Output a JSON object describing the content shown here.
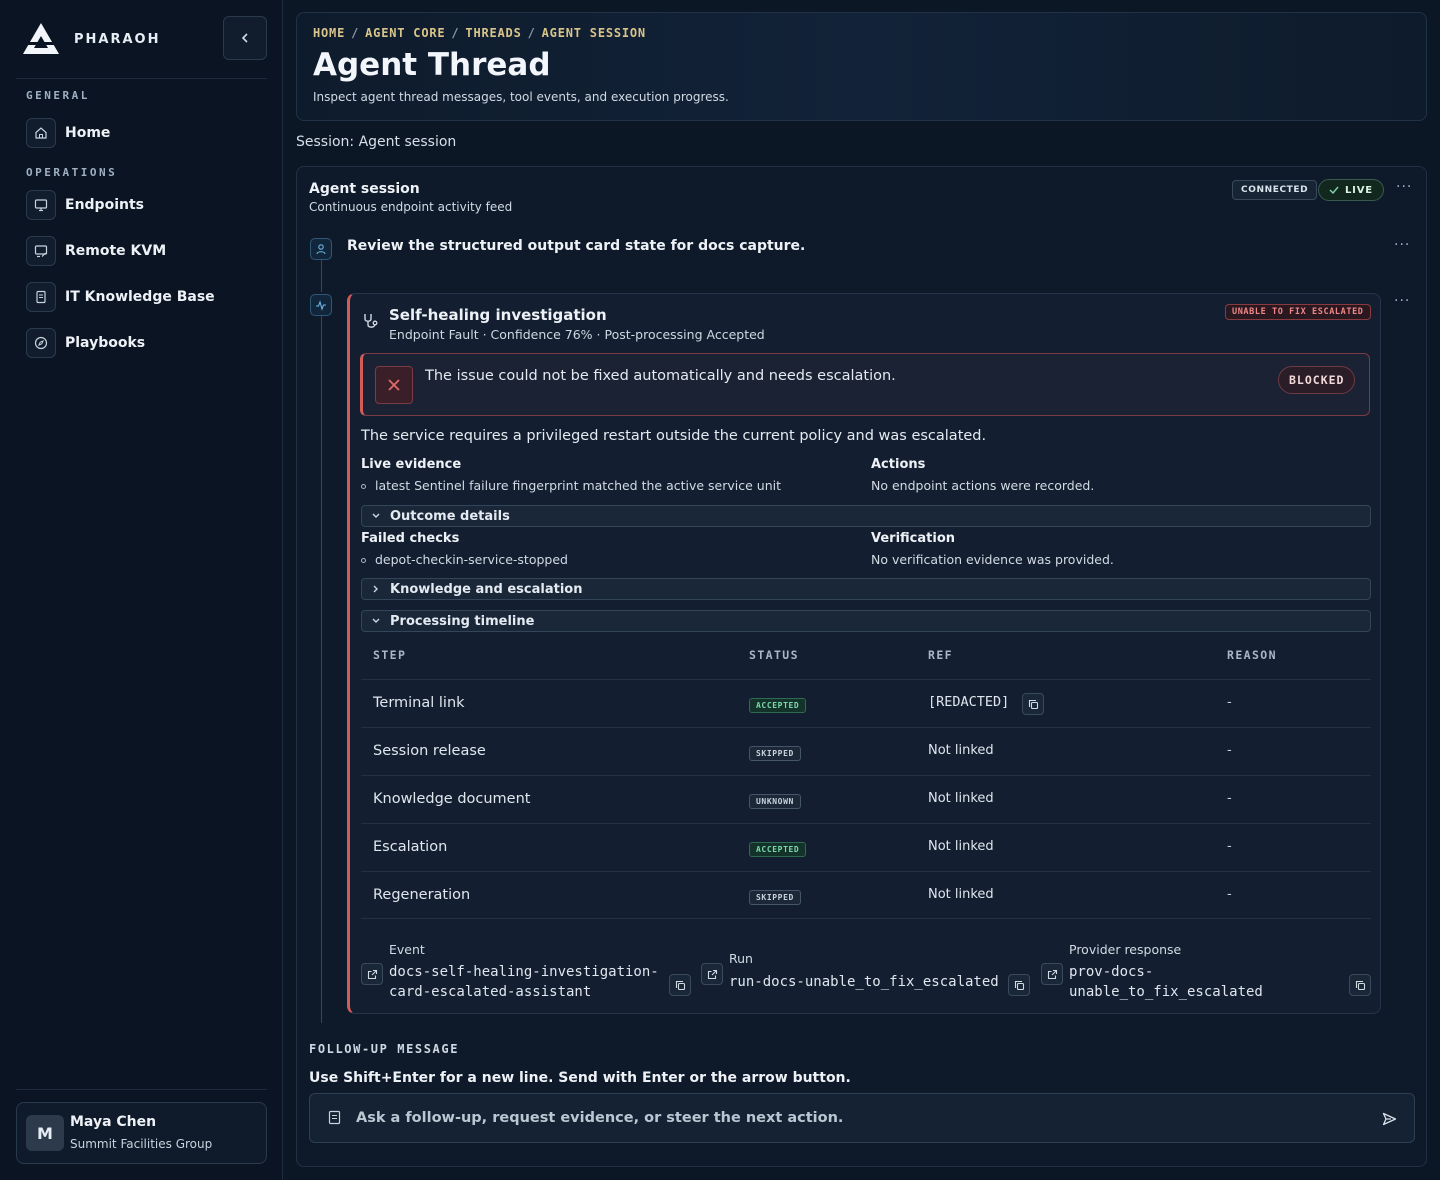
{
  "brand": {
    "name": "PHARAOH",
    "collapse_icon": "chevron-left-icon"
  },
  "sidebar": {
    "sections": [
      {
        "label": "GENERAL"
      },
      {
        "label": "OPERATIONS"
      }
    ],
    "items": [
      {
        "label": "Home",
        "icon": "home-icon"
      },
      {
        "label": "Endpoints",
        "icon": "monitor-icon"
      },
      {
        "label": "Remote KVM",
        "icon": "remote-screen-icon"
      },
      {
        "label": "IT Knowledge Base",
        "icon": "book-icon"
      },
      {
        "label": "Playbooks",
        "icon": "compass-icon"
      }
    ],
    "user": {
      "initial": "M",
      "name": "Maya Chen",
      "org": "Summit Facilities Group"
    }
  },
  "header": {
    "breadcrumb": [
      "HOME",
      "AGENT CORE",
      "THREADS",
      "AGENT SESSION"
    ],
    "title": "Agent Thread",
    "subtitle": "Inspect agent thread messages, tool events, and execution progress."
  },
  "session_label": "Session: Agent session",
  "session": {
    "title": "Agent session",
    "subtitle": "Continuous endpoint activity feed",
    "connected_badge": "CONNECTED",
    "live_badge": "LIVE",
    "more": "···"
  },
  "user_message": "Review the structured output card state for docs capture.",
  "investigation": {
    "title": "Self-healing investigation",
    "meta": "Endpoint Fault · Confidence 76% · Post-processing Accepted",
    "status_badge": "UNABLE TO FIX ESCALATED",
    "alert_text": "The issue could not be fixed automatically and needs escalation.",
    "alert_badge": "BLOCKED",
    "summary": "The service requires a privileged restart outside the current policy and was escalated.",
    "live_evidence_heading": "Live evidence",
    "live_evidence_item": "latest Sentinel failure fingerprint matched the active service unit",
    "actions_heading": "Actions",
    "actions_text": "No endpoint actions were recorded.",
    "outcome_label": "Outcome details",
    "failed_checks_heading": "Failed checks",
    "failed_checks_item": "depot-checkin-service-stopped",
    "verification_heading": "Verification",
    "verification_text": "No verification evidence was provided.",
    "knowledge_label": "Knowledge and escalation",
    "timeline_label": "Processing timeline",
    "timeline_headers": [
      "STEP",
      "STATUS",
      "REF",
      "REASON"
    ],
    "timeline_rows": [
      {
        "step": "Terminal link",
        "status": "ACCEPTED",
        "ref": "[REDACTED]",
        "reason": "-"
      },
      {
        "step": "Session release",
        "status": "SKIPPED",
        "ref": "Not linked",
        "reason": "-"
      },
      {
        "step": "Knowledge document",
        "status": "UNKNOWN",
        "ref": "Not linked",
        "reason": "-"
      },
      {
        "step": "Escalation",
        "status": "ACCEPTED",
        "ref": "Not linked",
        "reason": "-"
      },
      {
        "step": "Regeneration",
        "status": "SKIPPED",
        "ref": "Not linked",
        "reason": "-"
      }
    ],
    "refs": {
      "event_label": "Event",
      "event_line1": "docs-self-healing-investigation-",
      "event_line2": "card-escalated-assistant",
      "run_label": "Run",
      "run_value": "run-docs-unable_to_fix_escalated",
      "provider_label": "Provider response",
      "provider_line1": "prov-docs-",
      "provider_line2": "unable_to_fix_escalated"
    }
  },
  "followup": {
    "label": "FOLLOW-UP MESSAGE",
    "hint": "Use Shift+Enter for a new line. Send with Enter or the arrow button.",
    "placeholder": "Ask a follow-up, request evidence, or steer the next action.",
    "value": ""
  },
  "colors": {
    "background": "#0c1726",
    "accent_gold": "#d9c48a",
    "danger": "#d35b5b",
    "success": "#7fd8ab"
  }
}
